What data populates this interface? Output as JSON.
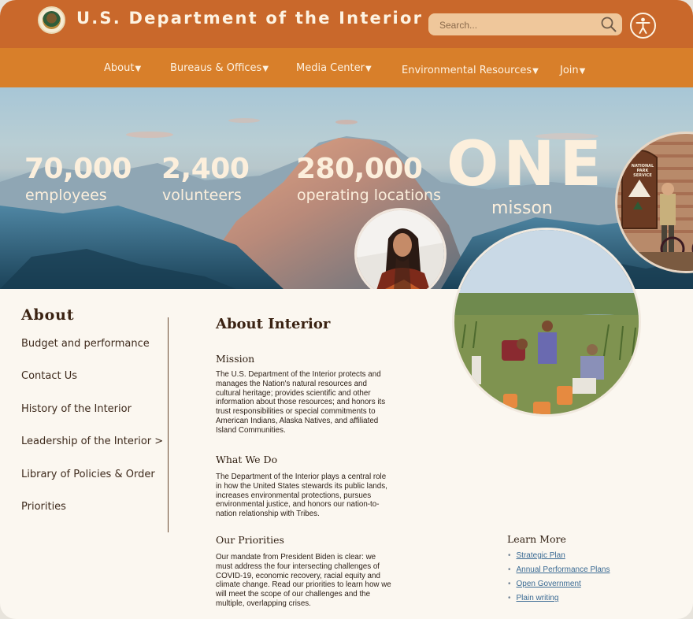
{
  "header": {
    "title": "U.S. Department of the Interior",
    "search": {
      "placeholder": "Search..."
    },
    "icons": {
      "seal": "doi-seal-icon",
      "search": "search-icon",
      "accessibility": "accessibility-icon"
    }
  },
  "nav": {
    "items": [
      {
        "label": "About"
      },
      {
        "label": "Bureaus & Offices"
      },
      {
        "label": "Media Center"
      },
      {
        "label": "Environmental Resources"
      },
      {
        "label": "Join"
      }
    ],
    "dropdown_glyph": "▼"
  },
  "hero": {
    "stats": [
      {
        "number": "70,000",
        "label": "employees"
      },
      {
        "number": "2,400",
        "label": "volunteers"
      },
      {
        "number": "280,000",
        "label": "operating locations"
      }
    ],
    "one": "ONE",
    "mission": "misson",
    "sign_text": [
      "NATIONAL",
      "PARK",
      "SERVICE"
    ]
  },
  "sidebar": {
    "heading": "About",
    "links": [
      {
        "label": "Budget and performance"
      },
      {
        "label": "Contact Us"
      },
      {
        "label": "History of the Interior"
      },
      {
        "label": "Leadership of the Interior >"
      },
      {
        "label": "Library of Policies & Order"
      },
      {
        "label": "Priorities"
      }
    ]
  },
  "main": {
    "title": "About Interior",
    "sections": [
      {
        "heading": "Mission",
        "body": "The U.S. Department of the Interior protects and manages the Nation's natural resources and cultural heritage; provides scientific and other information about those resources; and honors its trust responsibilities or special commitments to American Indians, Alaska Natives, and affiliated Island Communities."
      },
      {
        "heading": "What We Do",
        "body": "The Department of the Interior plays a central role in how the United States stewards its public lands, increases environmental protections, pursues environmental justice, and honors our nation-to-nation relationship with Tribes."
      },
      {
        "heading": "Our Priorities",
        "body": "Our mandate from President Biden is clear: we must address the four intersecting challenges of COVID-19, economic recovery, racial equity and climate change. Read our priorities to learn how we will meet the scope of our challenges and the multiple, overlapping crises."
      }
    ]
  },
  "learn_more": {
    "heading": "Learn More",
    "links": [
      {
        "label": "Strategic Plan"
      },
      {
        "label": "Annual Performance Plans"
      },
      {
        "label": "Open Government"
      },
      {
        "label": "Plain writing"
      }
    ],
    "bullet": "•"
  },
  "colors": {
    "header_bg": "#c9682b",
    "nav_bg": "#d87f2a",
    "page_bg": "#fbf7f0",
    "hero_text": "#fcefdc",
    "heading_text": "#3a2212",
    "link_blue": "#3a6a93"
  }
}
